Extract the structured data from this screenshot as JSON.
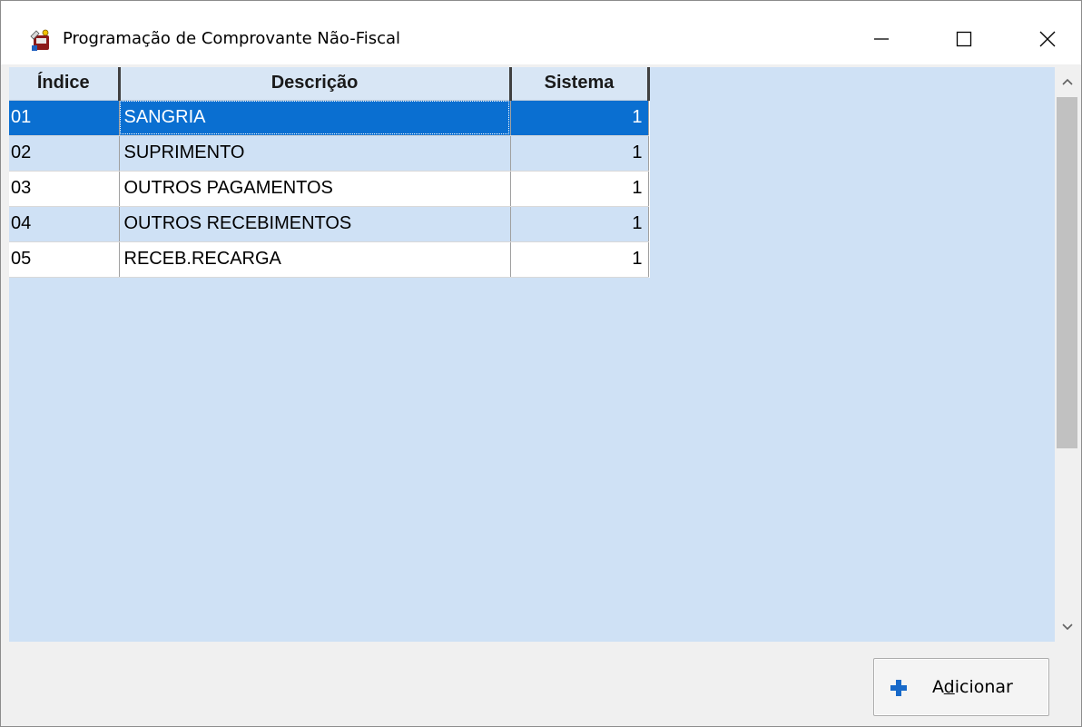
{
  "window": {
    "title": "Programação de Comprovante Não-Fiscal",
    "icon": "app-icon"
  },
  "grid": {
    "columns": [
      "Índice",
      "Descrição",
      "Sistema"
    ],
    "rows": [
      {
        "indice": "01",
        "descricao": "SANGRIA",
        "sistema": "1"
      },
      {
        "indice": "02",
        "descricao": "SUPRIMENTO",
        "sistema": "1"
      },
      {
        "indice": "03",
        "descricao": "OUTROS PAGAMENTOS",
        "sistema": "1"
      },
      {
        "indice": "04",
        "descricao": "OUTROS RECEBIMENTOS",
        "sistema": "1"
      },
      {
        "indice": "05",
        "descricao": "RECEB.RECARGA",
        "sistema": "1"
      }
    ],
    "selected_row": "01"
  },
  "actions": {
    "add_label": "Adicionar",
    "add_icon": "plus-icon"
  },
  "colors": {
    "grid_background": "#cfe1f5",
    "selection": "#0a6fd1",
    "add_icon": "#1769c9"
  }
}
